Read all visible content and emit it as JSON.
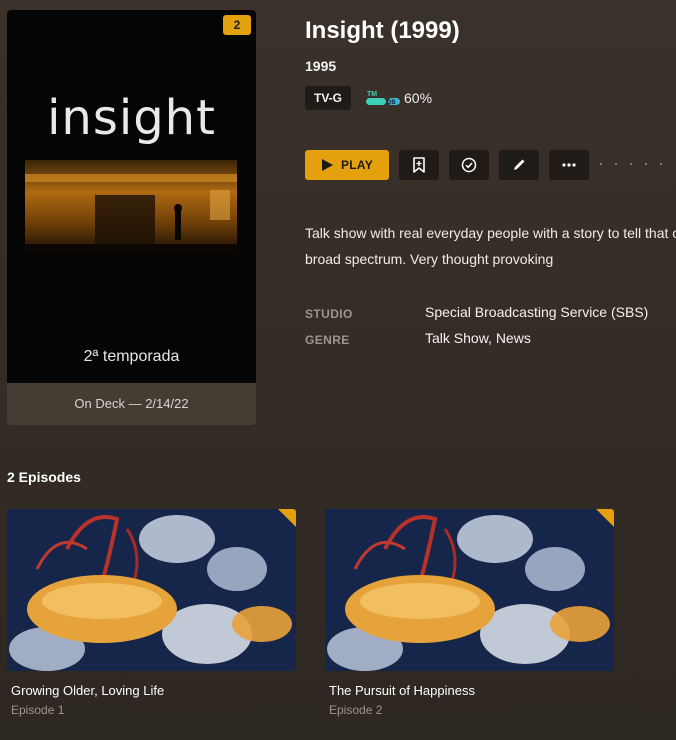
{
  "poster": {
    "title_text": "insight",
    "season_text": "2ª temporada",
    "unwatched_count": "2",
    "on_deck": "On Deck — 2/14/22"
  },
  "show": {
    "title": "Insight (1999)",
    "year": "1995",
    "content_rating": "TV-G",
    "tmdb_logo_text": "TMDB",
    "tmdb_score": "60%",
    "summary_line1": "Talk show with real everyday people with a story to tell that covers a",
    "summary_line2": "broad spectrum. Very thought provoking"
  },
  "actions": {
    "play_label": "PLAY",
    "icons": [
      "bookmark-icon",
      "check-circle-icon",
      "edit-pencil-icon",
      "more-icon"
    ]
  },
  "meta": {
    "studio_label": "STUDIO",
    "studio_value": "Special Broadcasting Service (SBS)",
    "genre_label": "GENRE",
    "genre_value": "Talk Show, News"
  },
  "episodes": {
    "heading": "2 Episodes",
    "items": [
      {
        "title": "Growing Older, Loving Life",
        "subtitle": "Episode 1"
      },
      {
        "title": "The Pursuit of Happiness",
        "subtitle": "Episode 2"
      }
    ]
  },
  "colors": {
    "accent": "#e5a00d",
    "background": "#3a322a",
    "button_dark": "#1f1b18",
    "muted_text": "#9d958c"
  }
}
